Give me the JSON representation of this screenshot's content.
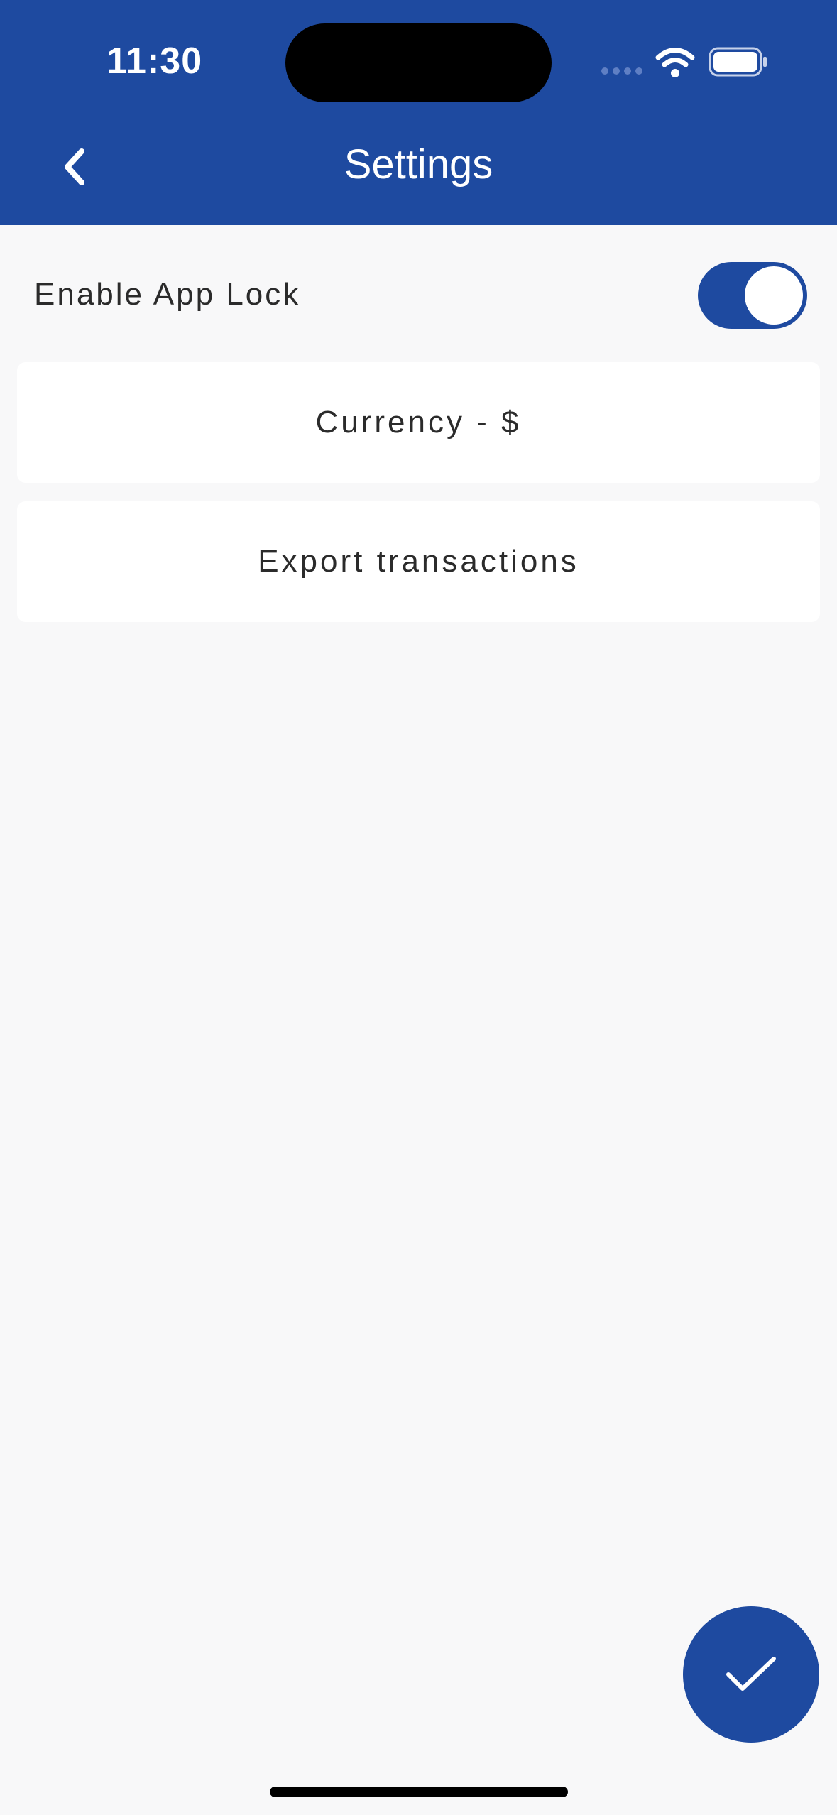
{
  "status_bar": {
    "time": "11:30",
    "icons": [
      "cellular-signal-icon",
      "wifi-icon",
      "battery-icon"
    ]
  },
  "header": {
    "title": "Settings",
    "back_icon": "chevron-left-icon"
  },
  "settings": {
    "app_lock": {
      "label": "Enable App Lock",
      "enabled": true
    },
    "currency_label": "Currency - $",
    "export_label": "Export transactions"
  },
  "fab": {
    "icon": "checkmark-icon"
  },
  "colors": {
    "primary": "#1e4aa0",
    "background": "#f8f8f9",
    "card": "#ffffff",
    "text": "#2b2b2b"
  }
}
